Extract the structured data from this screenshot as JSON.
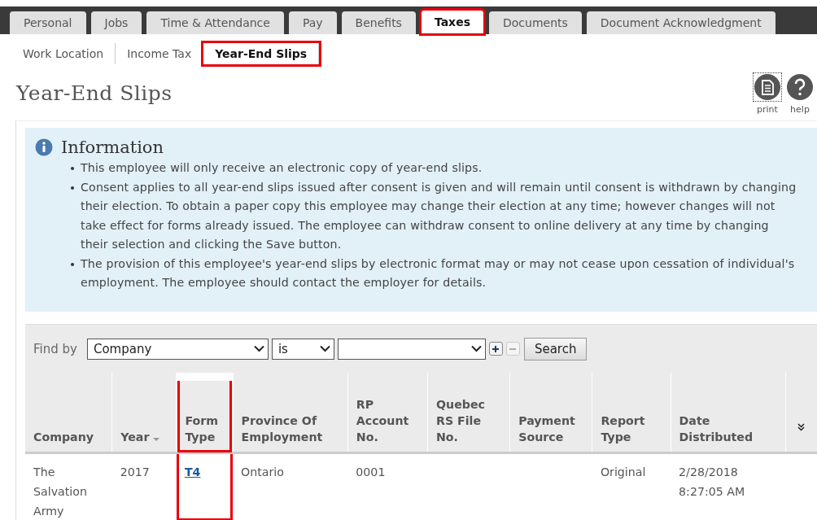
{
  "tabs": [
    {
      "label": "Personal",
      "selected": false,
      "highlighted": false
    },
    {
      "label": "Jobs",
      "selected": false,
      "highlighted": false
    },
    {
      "label": "Time & Attendance",
      "selected": false,
      "highlighted": false
    },
    {
      "label": "Pay",
      "selected": false,
      "highlighted": false
    },
    {
      "label": "Benefits",
      "selected": false,
      "highlighted": false
    },
    {
      "label": "Taxes",
      "selected": true,
      "highlighted": true
    },
    {
      "label": "Documents",
      "selected": false,
      "highlighted": false
    },
    {
      "label": "Document Acknowledgment",
      "selected": false,
      "highlighted": false
    }
  ],
  "subtabs": [
    {
      "label": "Work Location",
      "selected": false,
      "highlighted": false
    },
    {
      "label": "Income Tax",
      "selected": false,
      "highlighted": false
    },
    {
      "label": "Year-End Slips",
      "selected": true,
      "highlighted": true
    }
  ],
  "page_title": "Year-End Slips",
  "toolbar": [
    {
      "kind": "print",
      "label": "print"
    },
    {
      "kind": "help",
      "label": "help"
    }
  ],
  "information": {
    "title": "Information",
    "items": [
      "This employee will only receive an electronic copy of year-end slips.",
      "Consent applies to all year-end slips issued after consent is given and will remain until consent is withdrawn by changing their election. To obtain a paper copy this employee may change their election at any time; however changes will not take effect for forms already issued. The employee can withdraw consent to online delivery at any time by changing their selection and clicking the Save button.",
      "The provision of this employee's year-end slips by electronic format may or may not cease upon cessation of individual's employment. The employee should contact the employer for details."
    ]
  },
  "filter": {
    "label": "Find by",
    "field": "Company",
    "operator": "is",
    "search_button": "Search"
  },
  "table": {
    "columns": [
      {
        "label": "Company"
      },
      {
        "label": "Year",
        "sorted": true
      },
      {
        "label": "Form Type",
        "link": true,
        "highlighted": true
      },
      {
        "label": "Province Of Employment"
      },
      {
        "label": "RP Account No."
      },
      {
        "label": "Quebec RS File No."
      },
      {
        "label": "Payment Source"
      },
      {
        "label": "Report Type"
      },
      {
        "label": "Date Distributed"
      }
    ],
    "rows": [
      {
        "cells": [
          "The Salvation Army",
          "2017",
          "T4",
          "Ontario",
          "0001",
          "",
          "",
          "Original",
          "2/28/2018 8:27:05 AM"
        ]
      }
    ]
  }
}
